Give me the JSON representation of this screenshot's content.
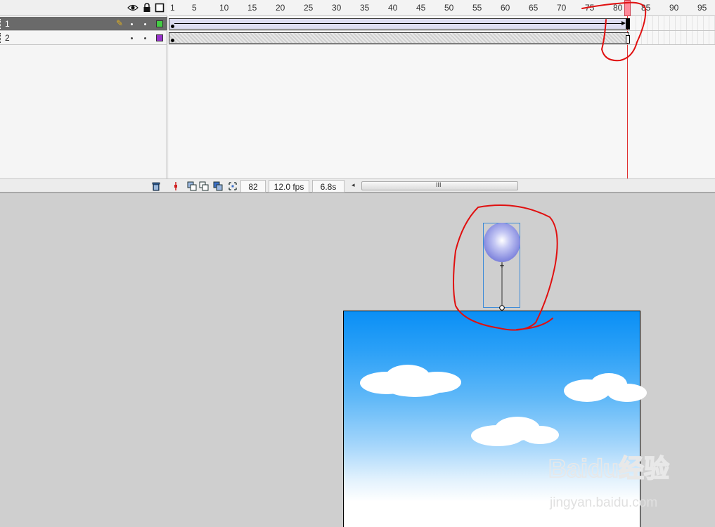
{
  "timeline": {
    "header_icons": [
      "eye-icon",
      "lock-icon",
      "outline-icon"
    ],
    "layers": [
      {
        "name": "1",
        "selected": true,
        "color": "#44cc44"
      },
      {
        "name": "2",
        "selected": false,
        "color": "#9933cc"
      }
    ],
    "ruler": {
      "labels": [
        "1",
        "5",
        "10",
        "15",
        "20",
        "25",
        "30",
        "35",
        "40",
        "45",
        "50",
        "55",
        "60",
        "65",
        "70",
        "75",
        "80",
        "85",
        "90",
        "95"
      ]
    },
    "current_frame": "82",
    "frame_rate": "12.0 fps",
    "elapsed_time": "6.8s",
    "scroll_grip": "III",
    "scroll_left_arrow": "◂"
  },
  "watermark": {
    "brand": "Baidu经验",
    "url": "jingyan.baidu.com"
  },
  "colors": {
    "annotation_red": "#e01010",
    "playhead": "#ff8a9a",
    "balloon": "#7f84e0"
  }
}
